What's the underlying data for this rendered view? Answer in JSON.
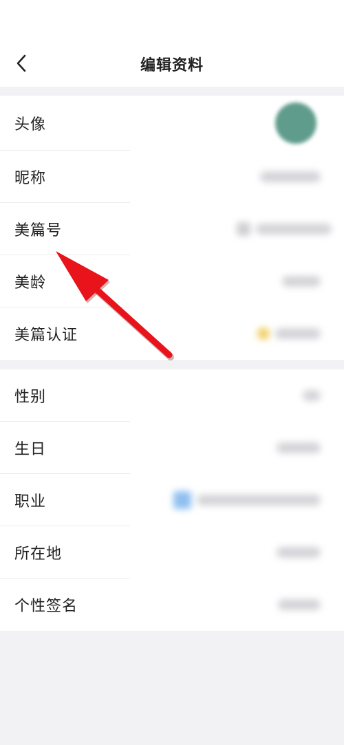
{
  "header": {
    "title": "编辑资料",
    "back_icon": "chevron-left-icon"
  },
  "profile_section": [
    {
      "key": "avatar",
      "label": "头像"
    },
    {
      "key": "nickname",
      "label": "昵称"
    },
    {
      "key": "meipian_id",
      "label": "美篇号"
    },
    {
      "key": "meipian_age",
      "label": "美龄"
    },
    {
      "key": "meipian_certification",
      "label": "美篇认证"
    }
  ],
  "personal_section": [
    {
      "key": "gender",
      "label": "性别"
    },
    {
      "key": "birthday",
      "label": "生日"
    },
    {
      "key": "occupation",
      "label": "职业"
    },
    {
      "key": "location",
      "label": "所在地"
    },
    {
      "key": "signature",
      "label": "个性签名"
    }
  ],
  "annotation": {
    "type": "arrow",
    "color": "#e8131b",
    "points_to": "美篇号"
  },
  "colors": {
    "background": "#f2f2f5",
    "card": "#ffffff",
    "avatar": "#5f9c8c"
  }
}
